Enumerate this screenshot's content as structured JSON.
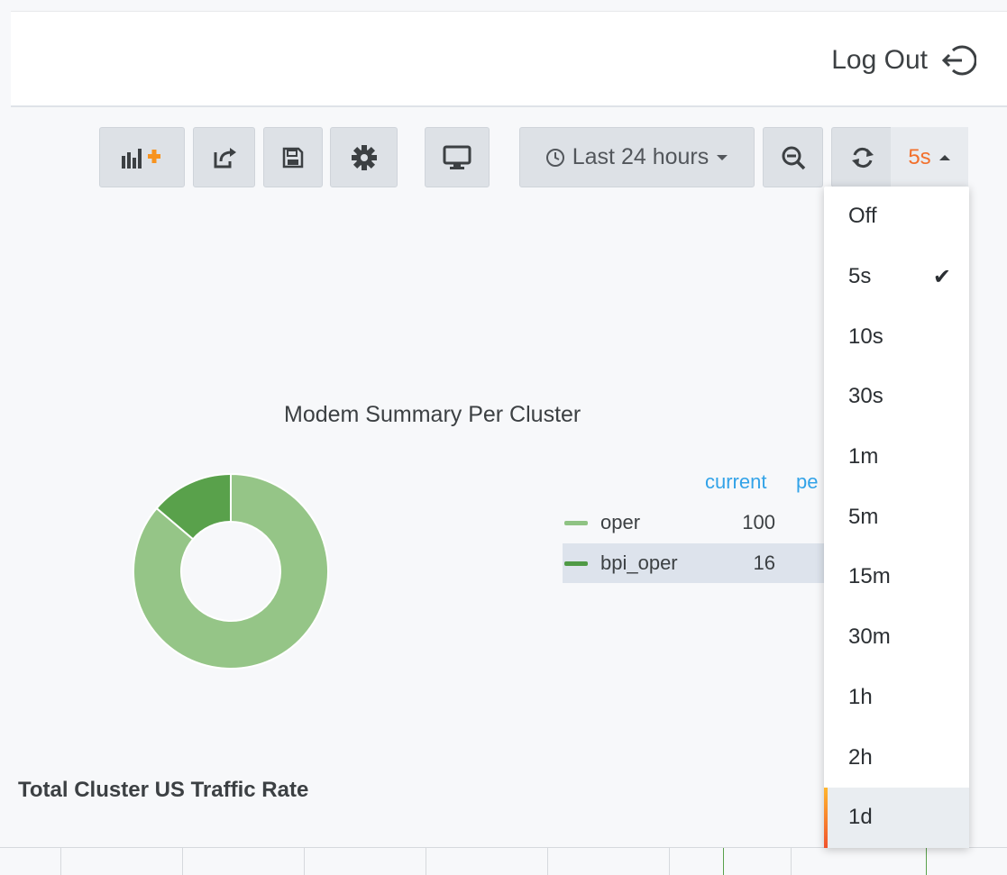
{
  "header": {
    "logout_label": "Log Out"
  },
  "toolbar": {
    "time_range": "Last 24 hours",
    "refresh_interval": "5s"
  },
  "refresh_menu": {
    "selected": "5s",
    "options": [
      "Off",
      "5s",
      "10s",
      "30s",
      "1m",
      "5m",
      "15m",
      "30m",
      "1h",
      "2h",
      "1d"
    ]
  },
  "panel": {
    "title": "Modem Summary Per Cluster",
    "legend_columns": [
      "current",
      "pe"
    ],
    "legend": [
      {
        "name": "oper",
        "current": "100",
        "color": "#8fc383"
      },
      {
        "name": "bpi_oper",
        "current": "16",
        "color": "#4f9a45"
      }
    ]
  },
  "chart_data": {
    "type": "pie",
    "title": "Modem Summary Per Cluster",
    "categories": [
      "oper",
      "bpi_oper"
    ],
    "values": [
      100,
      16
    ],
    "colors": [
      "#95c587",
      "#59a14b"
    ],
    "donut": true,
    "legend_placement": "right"
  },
  "bottom_panel": {
    "title": "Total Cluster US Traffic Rate"
  }
}
